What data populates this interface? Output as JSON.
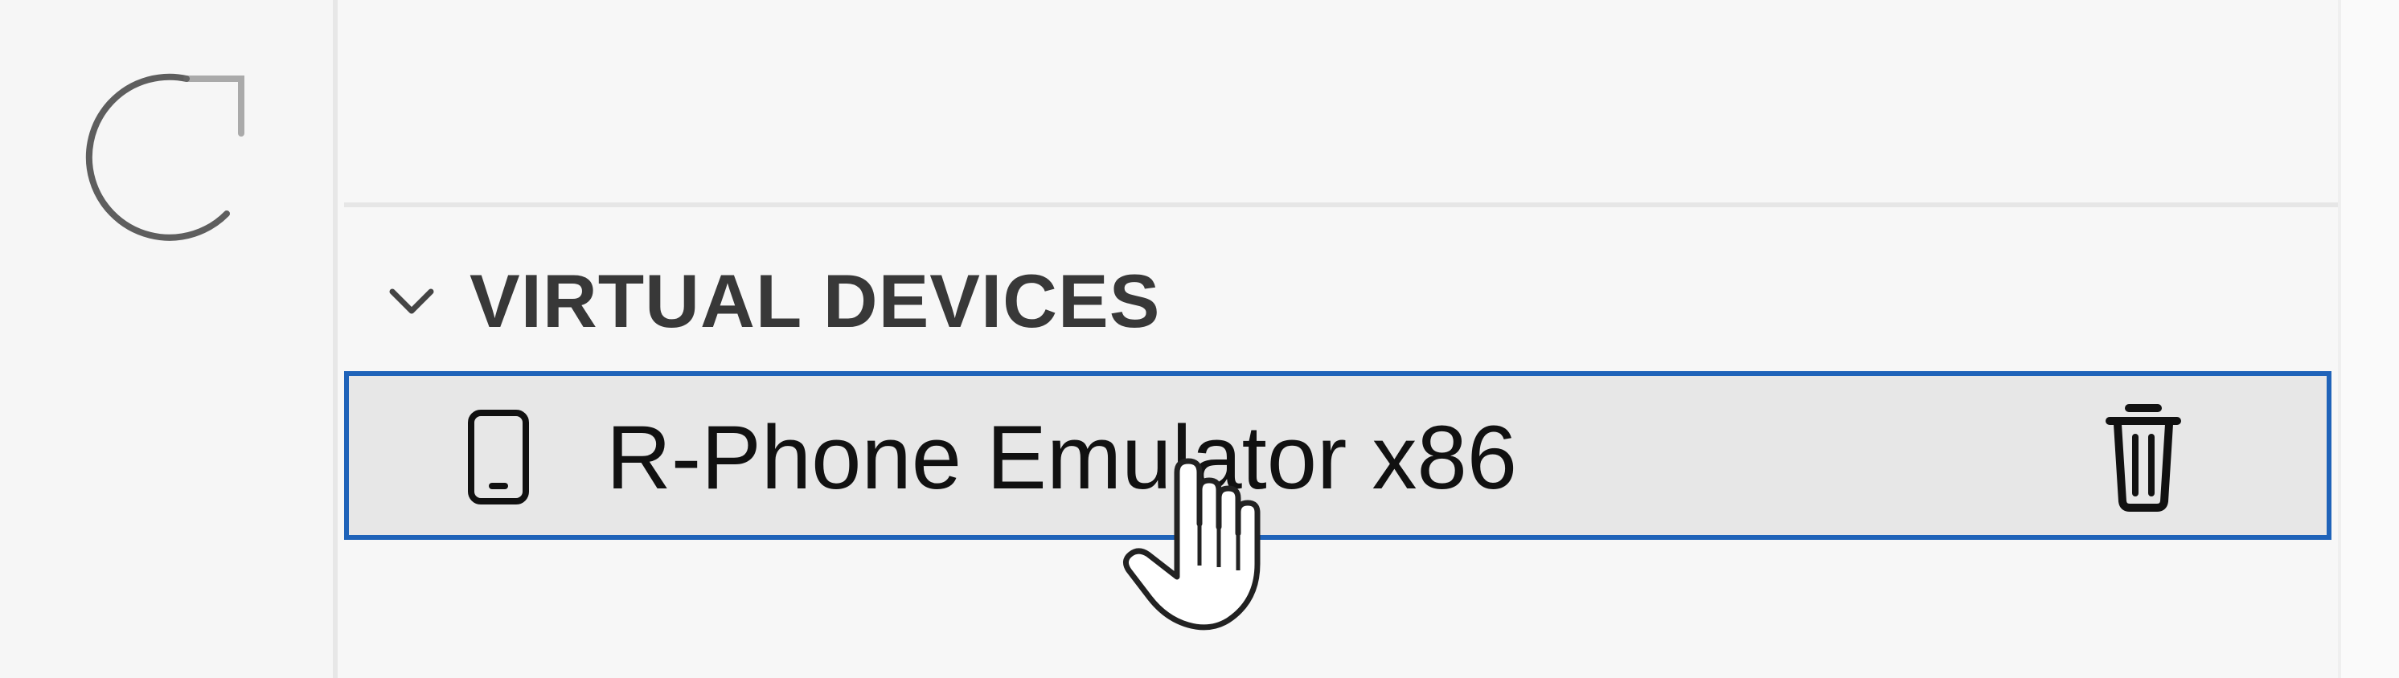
{
  "panel": {
    "section_title": "VIRTUAL DEVICES"
  },
  "device": {
    "name": "R-Phone Emulator x86"
  },
  "icons": {
    "loading": "loading-spinner-icon",
    "chevron": "chevron-down-icon",
    "phone": "phone-icon",
    "delete": "trash-icon",
    "cursor": "hand-pointer-cursor-icon"
  },
  "colors": {
    "selection_border": "#1f63b9",
    "row_background": "#e7e7e7",
    "text": "#111111",
    "section_title": "#383838"
  }
}
